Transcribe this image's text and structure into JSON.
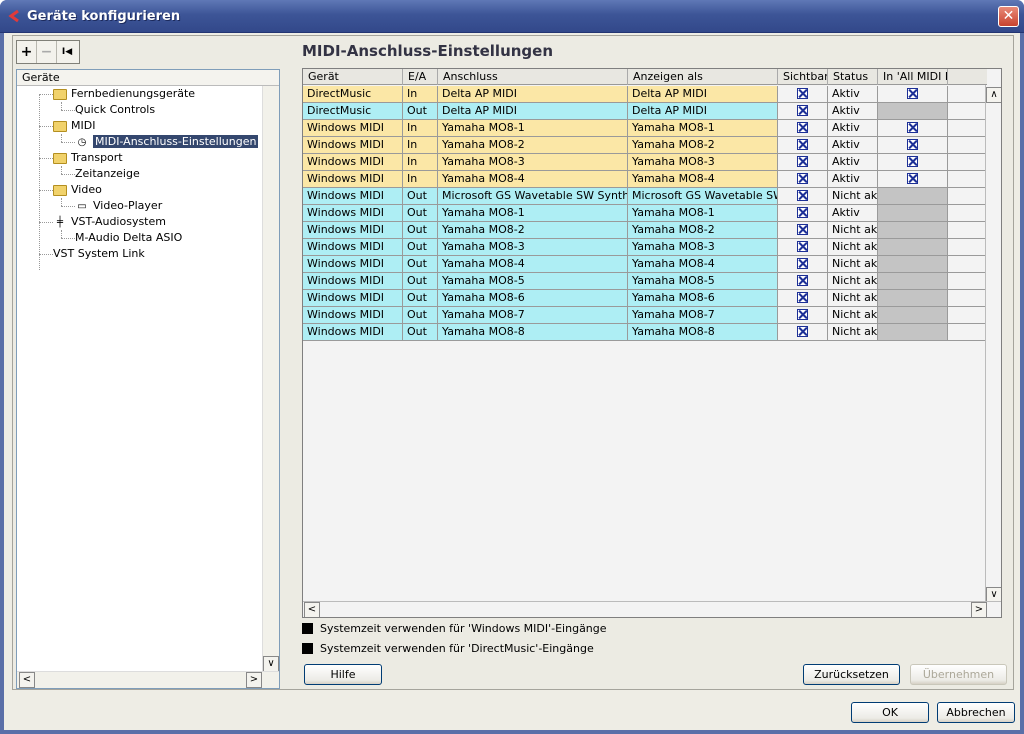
{
  "window": {
    "title": "Geräte konfigurieren"
  },
  "toolbar": {
    "add": "+",
    "remove": "−",
    "reset": "I◀"
  },
  "tree": {
    "header": "Geräte",
    "items": [
      {
        "label": "Fernbedienungsgeräte",
        "folder": true
      },
      {
        "label": "Quick Controls"
      },
      {
        "label": "MIDI",
        "folder": true
      },
      {
        "label": "MIDI-Anschluss-Einstellungen",
        "selected": true
      },
      {
        "label": "Transport",
        "folder": true
      },
      {
        "label": "Zeitanzeige"
      },
      {
        "label": "Video",
        "folder": true
      },
      {
        "label": "Video-Player"
      },
      {
        "label": "VST-Audiosystem"
      },
      {
        "label": "M-Audio Delta ASIO"
      },
      {
        "label": "VST System Link"
      }
    ]
  },
  "panel": {
    "title": "MIDI-Anschluss-Einstellungen"
  },
  "table": {
    "headers": [
      "Gerät",
      "E/A",
      "Anschluss",
      "Anzeigen als",
      "Sichtbar",
      "Status",
      "In 'All MIDI In"
    ],
    "rows": [
      {
        "device": "DirectMusic",
        "io": "In",
        "port": "Delta AP MIDI",
        "display": "Delta AP MIDI",
        "visible": true,
        "status": "Aktiv",
        "allmidi": "checked"
      },
      {
        "device": "DirectMusic",
        "io": "Out",
        "port": "Delta AP MIDI",
        "display": "Delta AP MIDI",
        "visible": true,
        "status": "Aktiv",
        "allmidi": "grey"
      },
      {
        "device": "Windows MIDI",
        "io": "In",
        "port": "Yamaha MO8-1",
        "display": "Yamaha MO8-1",
        "visible": true,
        "status": "Aktiv",
        "allmidi": "checked"
      },
      {
        "device": "Windows MIDI",
        "io": "In",
        "port": "Yamaha MO8-2",
        "display": "Yamaha MO8-2",
        "visible": true,
        "status": "Aktiv",
        "allmidi": "checked"
      },
      {
        "device": "Windows MIDI",
        "io": "In",
        "port": "Yamaha MO8-3",
        "display": "Yamaha MO8-3",
        "visible": true,
        "status": "Aktiv",
        "allmidi": "checked"
      },
      {
        "device": "Windows MIDI",
        "io": "In",
        "port": "Yamaha MO8-4",
        "display": "Yamaha MO8-4",
        "visible": true,
        "status": "Aktiv",
        "allmidi": "checked"
      },
      {
        "device": "Windows MIDI",
        "io": "Out",
        "port": "Microsoft GS Wavetable SW Synth",
        "display": "Microsoft GS Wavetable SW Synth",
        "visible": true,
        "status": "Nicht aktiv",
        "allmidi": "grey"
      },
      {
        "device": "Windows MIDI",
        "io": "Out",
        "port": "Yamaha MO8-1",
        "display": "Yamaha MO8-1",
        "visible": true,
        "status": "Aktiv",
        "allmidi": "grey"
      },
      {
        "device": "Windows MIDI",
        "io": "Out",
        "port": "Yamaha MO8-2",
        "display": "Yamaha MO8-2",
        "visible": true,
        "status": "Nicht aktiv",
        "allmidi": "grey"
      },
      {
        "device": "Windows MIDI",
        "io": "Out",
        "port": "Yamaha MO8-3",
        "display": "Yamaha MO8-3",
        "visible": true,
        "status": "Nicht aktiv",
        "allmidi": "grey"
      },
      {
        "device": "Windows MIDI",
        "io": "Out",
        "port": "Yamaha MO8-4",
        "display": "Yamaha MO8-4",
        "visible": true,
        "status": "Nicht aktiv",
        "allmidi": "grey"
      },
      {
        "device": "Windows MIDI",
        "io": "Out",
        "port": "Yamaha MO8-5",
        "display": "Yamaha MO8-5",
        "visible": true,
        "status": "Nicht aktiv",
        "allmidi": "grey"
      },
      {
        "device": "Windows MIDI",
        "io": "Out",
        "port": "Yamaha MO8-6",
        "display": "Yamaha MO8-6",
        "visible": true,
        "status": "Nicht aktiv",
        "allmidi": "grey"
      },
      {
        "device": "Windows MIDI",
        "io": "Out",
        "port": "Yamaha MO8-7",
        "display": "Yamaha MO8-7",
        "visible": true,
        "status": "Nicht aktiv",
        "allmidi": "grey"
      },
      {
        "device": "Windows MIDI",
        "io": "Out",
        "port": "Yamaha MO8-8",
        "display": "Yamaha MO8-8",
        "visible": true,
        "status": "Nicht aktiv",
        "allmidi": "grey"
      }
    ]
  },
  "options": {
    "windows_midi": "Systemzeit verwenden für 'Windows MIDI'-Eingänge",
    "directmusic": "Systemzeit verwenden für 'DirectMusic'-Eingänge"
  },
  "buttons": {
    "help": "Hilfe",
    "reset": "Zurücksetzen",
    "apply": "Übernehmen",
    "ok": "OK",
    "cancel": "Abbrechen"
  },
  "colors": {
    "row_in": "#fbe7a6",
    "row_out": "#aeeef4"
  }
}
